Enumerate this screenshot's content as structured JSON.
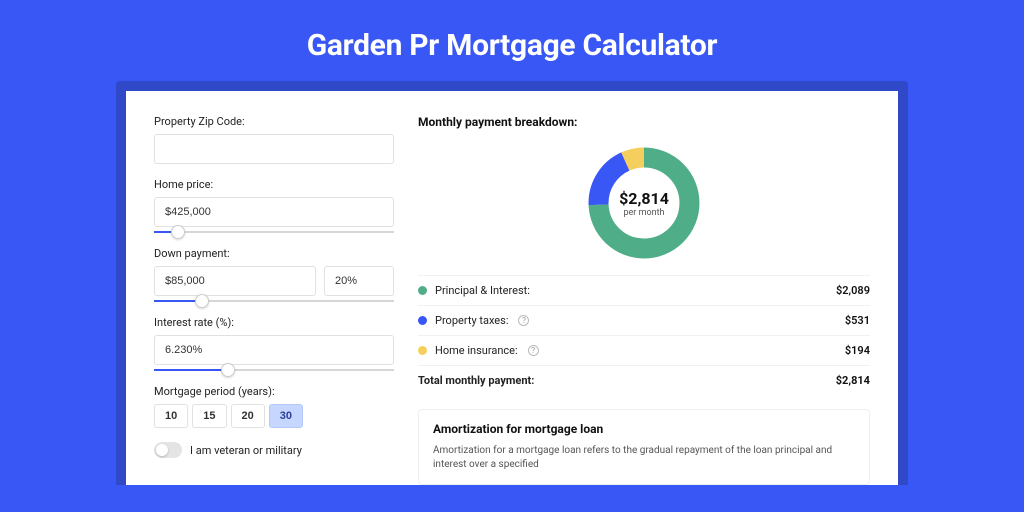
{
  "title": "Garden Pr Mortgage Calculator",
  "form": {
    "zip_label": "Property Zip Code:",
    "zip_value": "",
    "price_label": "Home price:",
    "price_value": "$425,000",
    "down_label": "Down payment:",
    "down_value": "$85,000",
    "down_pct": "20%",
    "rate_label": "Interest rate (%):",
    "rate_value": "6.230%",
    "period_label": "Mortgage period (years):",
    "periods": [
      "10",
      "15",
      "20",
      "30"
    ],
    "period_selected": "30",
    "veteran_label": "I am veteran or military"
  },
  "breakdown": {
    "title": "Monthly payment breakdown:",
    "center_value": "$2,814",
    "center_sub": "per month",
    "items": [
      {
        "label": "Principal & Interest:",
        "amount": "$2,089",
        "color": "#4fae87",
        "info": false
      },
      {
        "label": "Property taxes:",
        "amount": "$531",
        "color": "#3857f4",
        "info": true
      },
      {
        "label": "Home insurance:",
        "amount": "$194",
        "color": "#f4cf5e",
        "info": true
      }
    ],
    "total_label": "Total monthly payment:",
    "total_amount": "$2,814"
  },
  "amort": {
    "title": "Amortization for mortgage loan",
    "text": "Amortization for a mortgage loan refers to the gradual repayment of the loan principal and interest over a specified"
  },
  "chart_data": {
    "type": "pie",
    "title": "Monthly payment breakdown",
    "series": [
      {
        "name": "Principal & Interest",
        "value": 2089,
        "color": "#4fae87"
      },
      {
        "name": "Property taxes",
        "value": 531,
        "color": "#3857f4"
      },
      {
        "name": "Home insurance",
        "value": 194,
        "color": "#f4cf5e"
      }
    ],
    "total": 2814,
    "center_label": "$2,814 per month"
  }
}
